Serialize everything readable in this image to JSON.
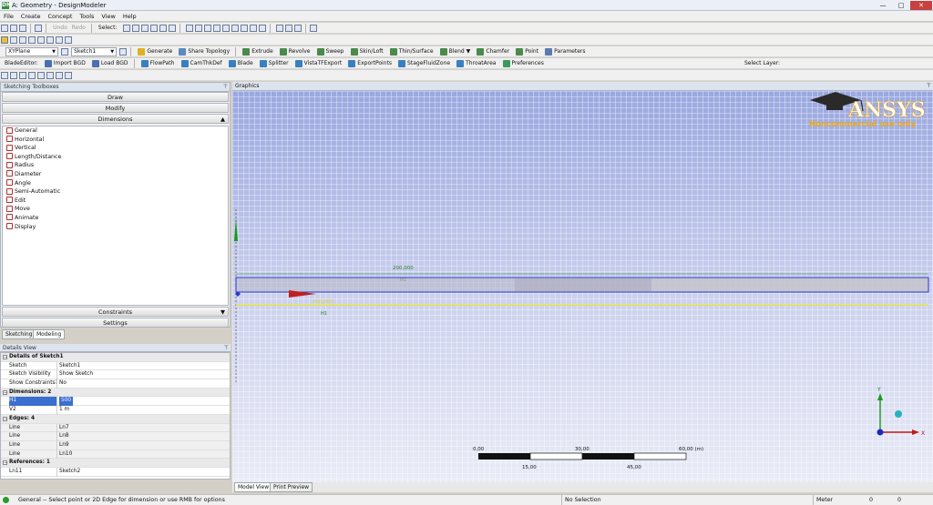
{
  "window": {
    "title": "A: Geometry - DesignModeler",
    "app_icon": "DM"
  },
  "menu": [
    "File",
    "Create",
    "Concept",
    "Tools",
    "View",
    "Help"
  ],
  "toolbar1": {
    "undo": "Undo",
    "redo": "Redo",
    "select": "Select:"
  },
  "toolbar3": {
    "plane": "XYPlane",
    "sketch": "Sketch1",
    "generate": "Generate",
    "share_topology": "Share Topology",
    "extrude": "Extrude",
    "revolve": "Revolve",
    "sweep": "Sweep",
    "skin_loft": "Skin/Loft",
    "thin_surface": "Thin/Surface",
    "blend": "Blend",
    "chamfer": "Chamfer",
    "point": "Point",
    "parameters": "Parameters"
  },
  "toolbar4": {
    "blade_editor": "BladeEditor:",
    "import_bgd": "Import BGD",
    "load_bgd": "Load BGD",
    "flowpath": "FlowPath",
    "camthkdef": "CamThkDef",
    "blade": "Blade",
    "splitter": "Splitter",
    "vista": "VistaTFExport",
    "export_points": "ExportPoints",
    "stage_fluid": "StageFluidZone",
    "throat": "ThroatArea",
    "preferences": "Preferences",
    "select_layer": "Select Layer:"
  },
  "toolbox": {
    "header": "Sketching Toolboxes",
    "draw": "Draw",
    "modify": "Modify",
    "dimensions": "Dimensions",
    "constraints": "Constraints",
    "settings": "Settings",
    "items": [
      "General",
      "Horizontal",
      "Vertical",
      "Length/Distance",
      "Radius",
      "Diameter",
      "Angle",
      "Semi-Automatic",
      "Edit",
      "Move",
      "Animate",
      "Display"
    ]
  },
  "tabs": {
    "sketching": "Sketching",
    "modeling": "Modeling"
  },
  "details": {
    "header": "Details View",
    "group1": "Details of Sketch1",
    "rows1": [
      {
        "k": "Sketch",
        "v": "Sketch1"
      },
      {
        "k": "Sketch Visibility",
        "v": "Show Sketch"
      },
      {
        "k": "Show Constraints?",
        "v": "No"
      }
    ],
    "group2": "Dimensions: 2",
    "dims": [
      {
        "k": "H1",
        "v": "500"
      },
      {
        "k": "V2",
        "v": "1 m"
      }
    ],
    "group3": "Edges: 4",
    "edges": [
      {
        "k": "Line",
        "v": "Ln7"
      },
      {
        "k": "Line",
        "v": "Ln8"
      },
      {
        "k": "Line",
        "v": "Ln9"
      },
      {
        "k": "Line",
        "v": "Ln10"
      }
    ],
    "group4": "References: 1",
    "refs": [
      {
        "k": "Ln11",
        "v": "Sketch2"
      }
    ]
  },
  "graphics": {
    "header": "Graphics",
    "logo": "ANSYS",
    "logo_sub": "Noncommercial use only",
    "dim_top": "200,000",
    "dim_top_sub": "H1",
    "dim_mid": "200,000",
    "dim_mid_sub": "H1",
    "scale": {
      "t0": "0,00",
      "t1": "30,00",
      "t2": "60,00 (m)",
      "b1": "15,00",
      "b2": "45,00"
    },
    "axis_y": "Y",
    "axis_x": "X"
  },
  "bottom_tabs": {
    "model": "Model View",
    "print": "Print Preview"
  },
  "status": {
    "message": "General -- Select point or 2D Edge for dimension or use RMB for options",
    "selection": "No Selection",
    "unit": "Meter",
    "v1": "0",
    "v2": "0"
  }
}
